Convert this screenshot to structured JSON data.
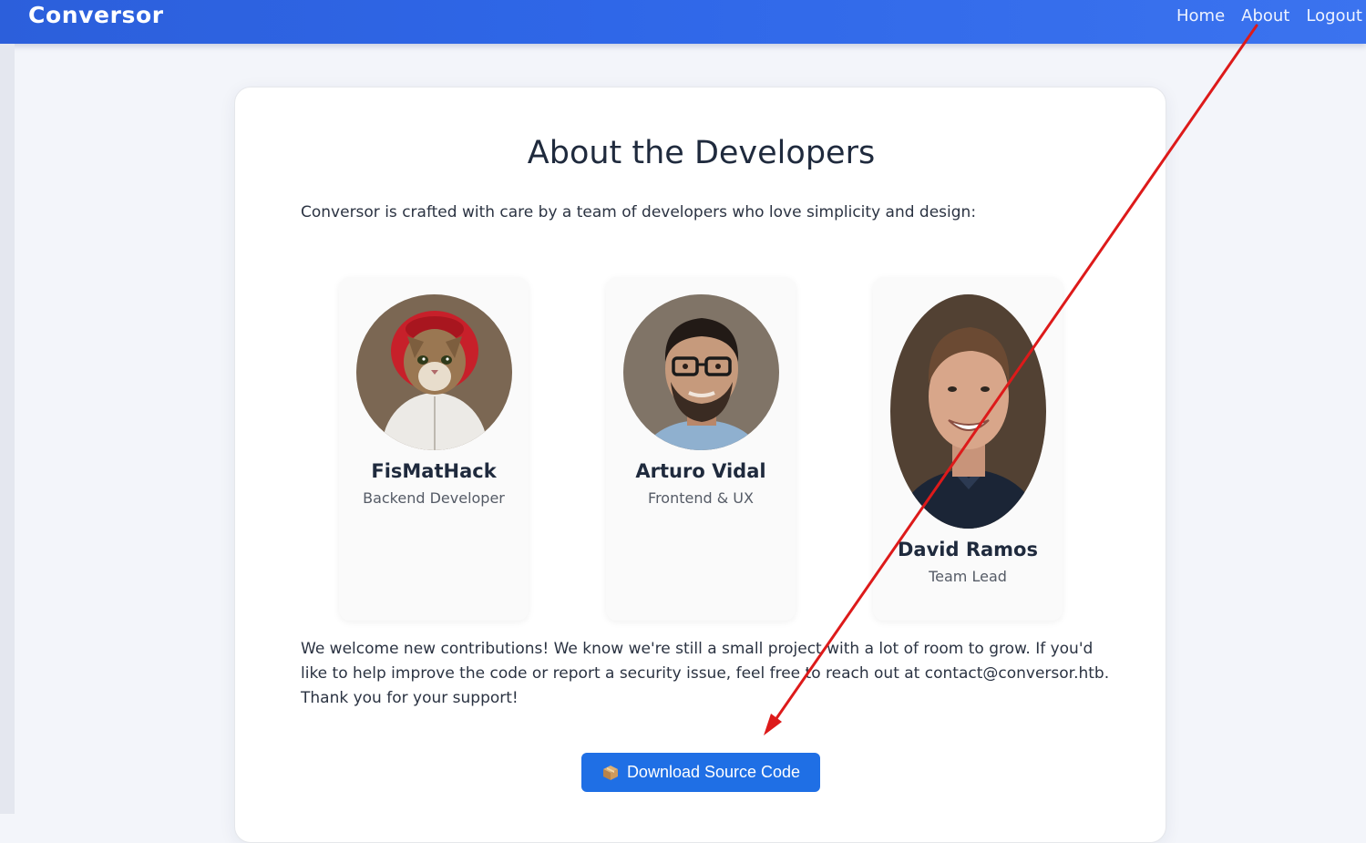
{
  "nav": {
    "brand": "Conversor",
    "links": [
      "Home",
      "About",
      "Logout"
    ]
  },
  "main": {
    "title": "About the Developers",
    "intro": "Conversor is crafted with care by a team of developers who love simplicity and design:",
    "developers": [
      {
        "name": "FisMatHack",
        "role": "Backend Developer",
        "avatar": "cat-in-red-hoodie-avatar"
      },
      {
        "name": "Arturo Vidal",
        "role": "Frontend & UX",
        "avatar": "man-with-glasses-avatar"
      },
      {
        "name": "David Ramos",
        "role": "Team Lead",
        "avatar": "smiling-man-avatar"
      }
    ],
    "outro": "We welcome new contributions! We know we're still a small project with a lot of room to grow. If you'd like to help improve the code or report a security issue, feel free to reach out at contact@conversor.htb. Thank you for your support!",
    "download_label": "Download Source Code",
    "download_icon": "package-icon"
  },
  "annotation": {
    "arrow_color": "#dd1a1a"
  }
}
